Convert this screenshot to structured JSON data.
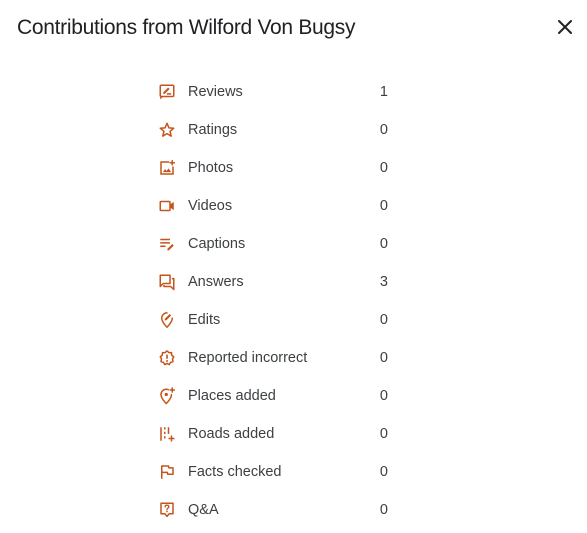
{
  "dialog": {
    "title": "Contributions from Wilford Von Bugsy"
  },
  "accent_color": "#c5541a",
  "stats": [
    {
      "label": "Reviews",
      "count": "1",
      "icon": "rate-review-icon"
    },
    {
      "label": "Ratings",
      "count": "0",
      "icon": "star-outline-icon"
    },
    {
      "label": "Photos",
      "count": "0",
      "icon": "add-photo-icon"
    },
    {
      "label": "Videos",
      "count": "0",
      "icon": "videocam-icon"
    },
    {
      "label": "Captions",
      "count": "0",
      "icon": "caption-edit-icon"
    },
    {
      "label": "Answers",
      "count": "3",
      "icon": "forum-icon"
    },
    {
      "label": "Edits",
      "count": "0",
      "icon": "edit-location-icon"
    },
    {
      "label": "Reported incorrect",
      "count": "0",
      "icon": "report-icon"
    },
    {
      "label": "Places added",
      "count": "0",
      "icon": "add-location-icon"
    },
    {
      "label": "Roads added",
      "count": "0",
      "icon": "add-road-icon"
    },
    {
      "label": "Facts checked",
      "count": "0",
      "icon": "flag-icon"
    },
    {
      "label": "Q&A",
      "count": "0",
      "icon": "question-answer-icon"
    }
  ]
}
